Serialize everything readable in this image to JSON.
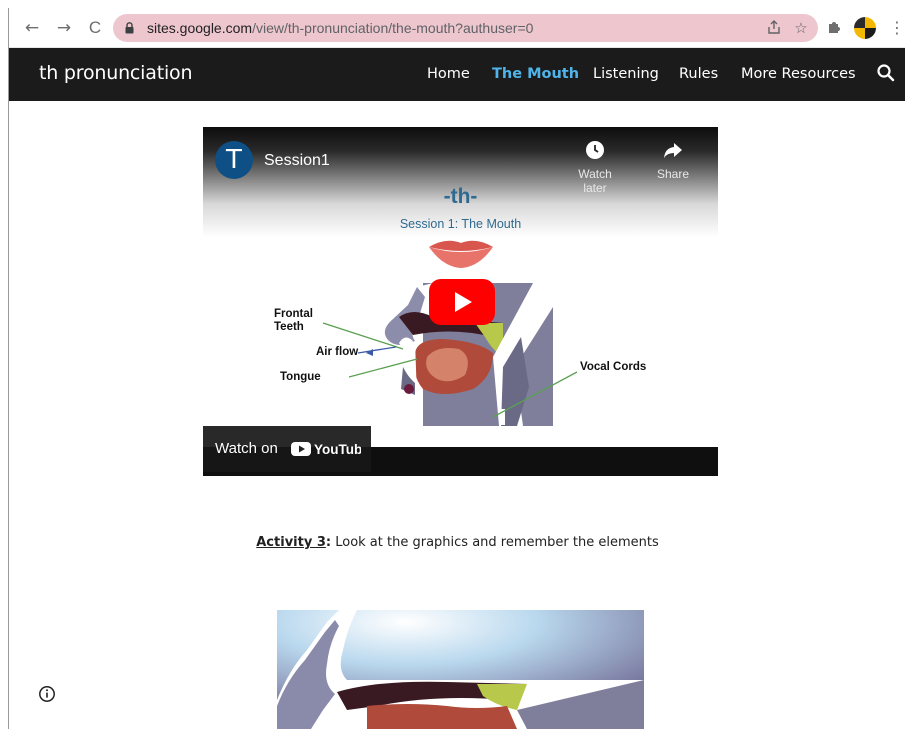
{
  "browser": {
    "url_host": "sites.google.com",
    "url_path": "/view/th-pronunciation/the-mouth?authuser=0",
    "nav": {
      "back": "←",
      "forward": "→",
      "reload": "C"
    },
    "menu_glyph": "⋮"
  },
  "site": {
    "title": "th pronunciation",
    "nav": [
      {
        "label": "Home",
        "active": false
      },
      {
        "label": "The Mouth",
        "active": true
      },
      {
        "label": "Listening",
        "active": false
      },
      {
        "label": "Rules",
        "active": false
      },
      {
        "label": "More Resources",
        "active": false
      }
    ]
  },
  "video": {
    "channel_initial": "T",
    "title": "Session1",
    "watch_later": "Watch later",
    "share": "Share",
    "slide_heading": "-th-",
    "slide_subtitle": "Session 1: The Mouth",
    "labels": {
      "frontal_teeth_1": "Frontal",
      "frontal_teeth_2": "Teeth",
      "air_flow": "Air flow",
      "tongue": "Tongue",
      "vocal_cords": "Vocal Cords"
    },
    "watch_on": "Watch on",
    "youtube": "YouTube"
  },
  "activity": {
    "link_text": "Activity 3",
    "colon": ":",
    "text": " Look at the graphics and remember the elements"
  },
  "colors": {
    "header_bg": "#1b1b1b",
    "nav_active": "#4fb4ea",
    "omnibox_bg": "#eec6cd",
    "slide_text": "#2f6a90"
  }
}
